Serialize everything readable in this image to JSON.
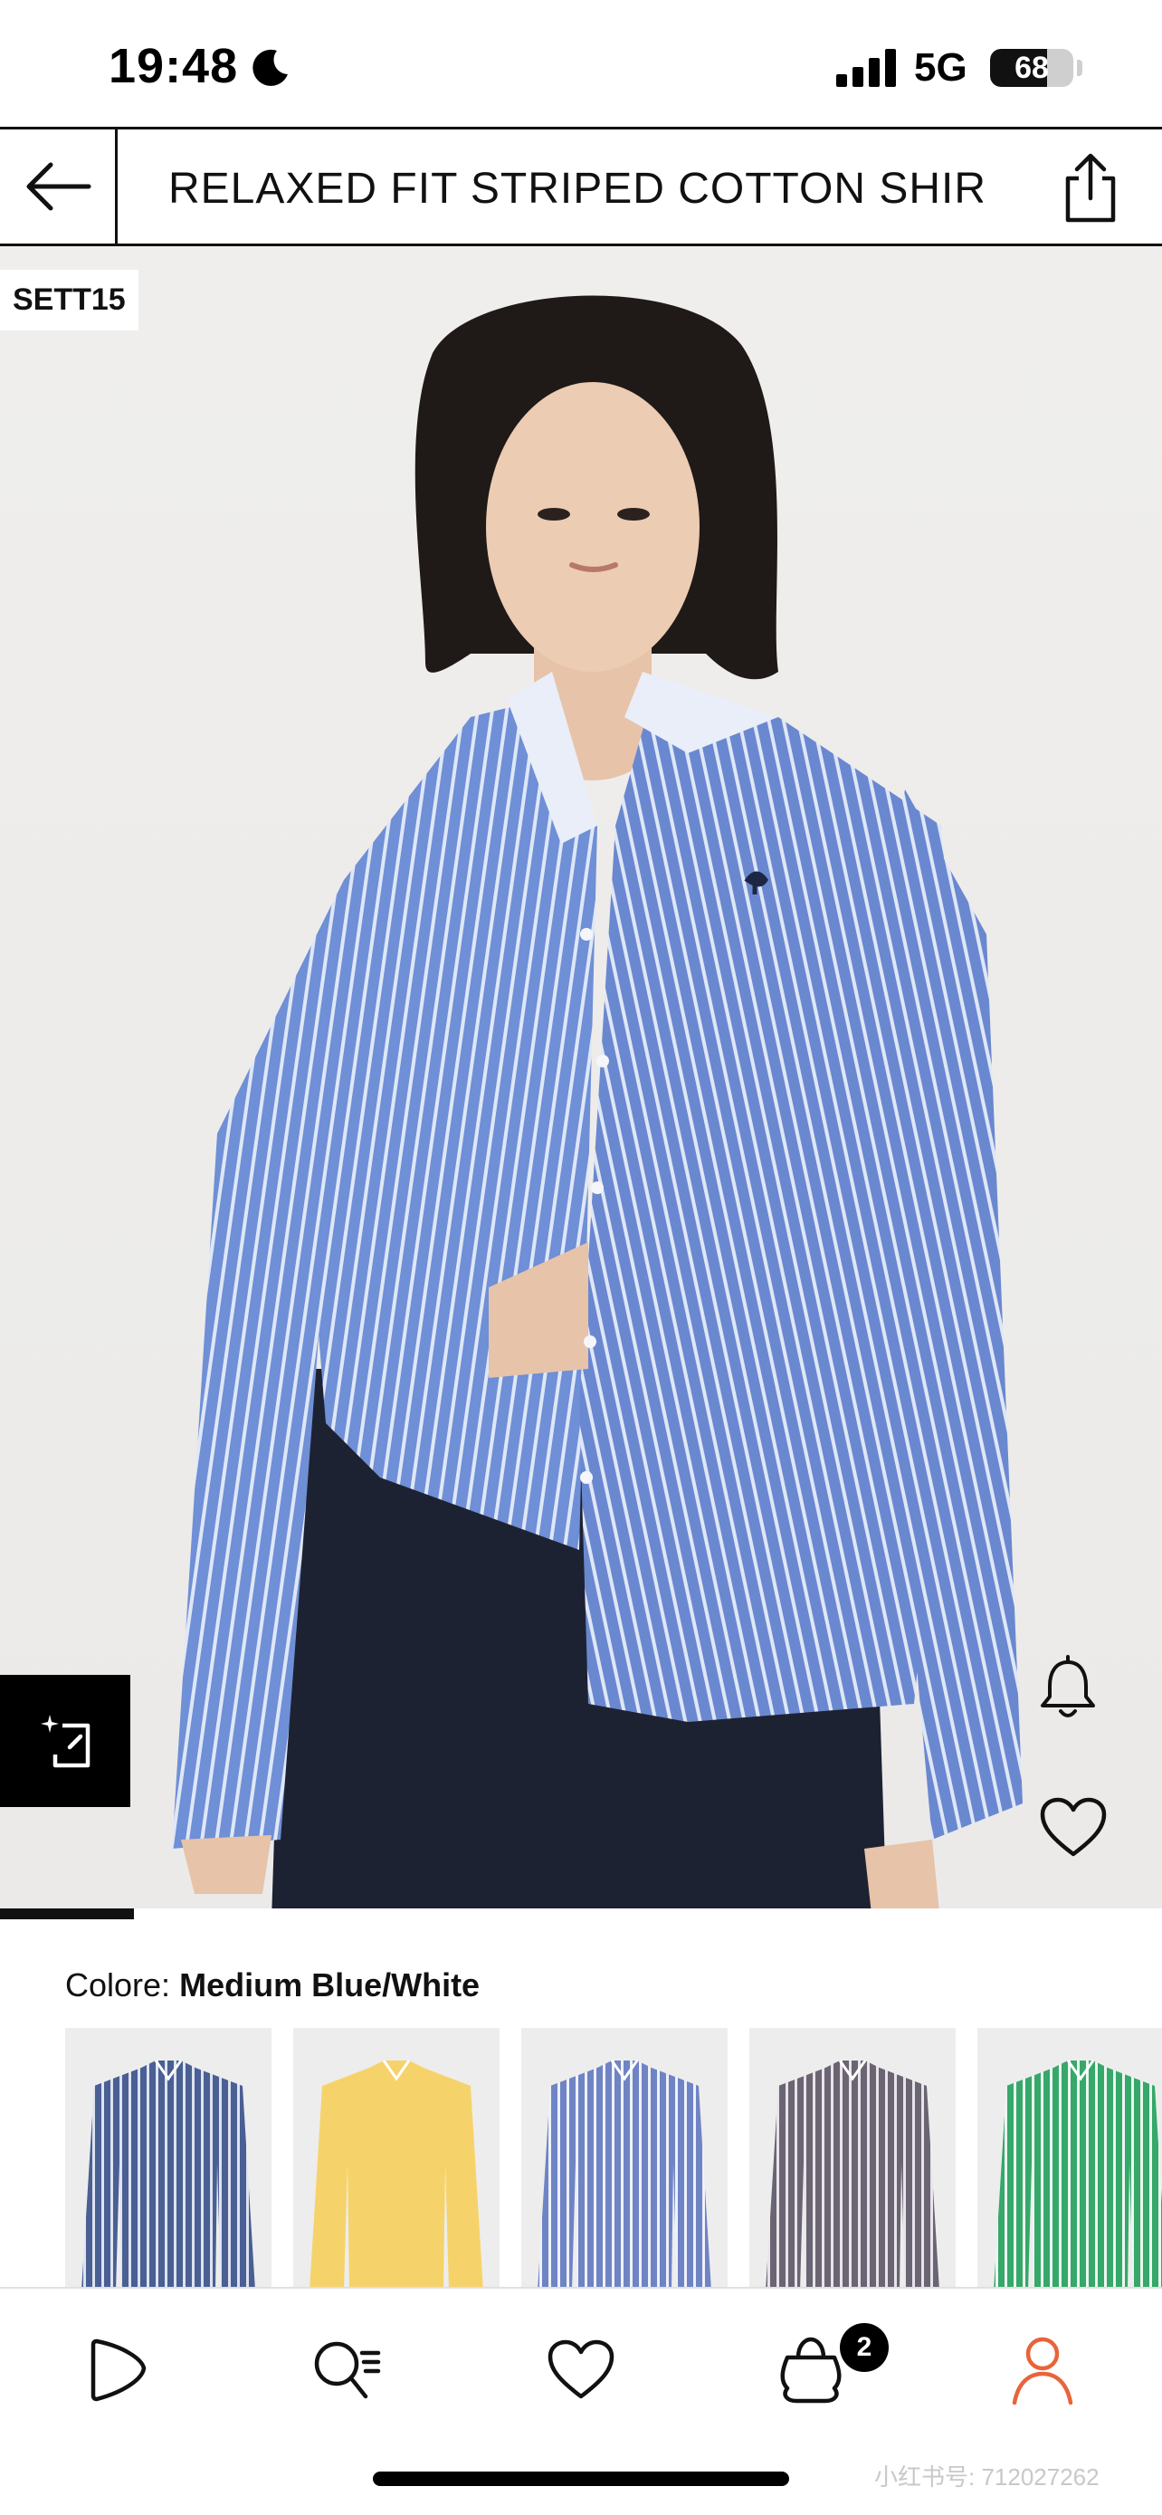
{
  "status_bar": {
    "time": "19:48",
    "network": "5G",
    "battery_level": "68",
    "battery_fraction": 0.68
  },
  "header": {
    "title": "RELAXED FIT STRIPED COTTON SHIR...",
    "back_icon": "arrow-left-icon",
    "share_icon": "share-icon"
  },
  "product": {
    "promo_tag": "SETT15",
    "image_progress_fraction": 0.115,
    "color_label": "Colore:",
    "color_value": "Medium Blue/White",
    "swatches": [
      {
        "name": "navy-stripe",
        "shirt_color": "#4a5f93",
        "stripe_color": "#dde3f0"
      },
      {
        "name": "yellow",
        "shirt_color": "#f6d36a",
        "stripe_color": "#f6d36a"
      },
      {
        "name": "blue-white-stripe",
        "shirt_color": "#6f84c4",
        "stripe_color": "#eef1fa"
      },
      {
        "name": "grey-stripe",
        "shirt_color": "#6b6472",
        "stripe_color": "#e7e4ea"
      },
      {
        "name": "green-stripe",
        "shirt_color": "#36a86a",
        "stripe_color": "#ecf7f0"
      }
    ]
  },
  "bottom_nav": {
    "items": [
      {
        "name": "home-icon"
      },
      {
        "name": "search-icon"
      },
      {
        "name": "wishlist-icon"
      },
      {
        "name": "bag-icon"
      },
      {
        "name": "account-icon"
      }
    ],
    "bag_count": "2",
    "active_color": "#e8643a"
  },
  "watermark": "小红书号: 712027262"
}
